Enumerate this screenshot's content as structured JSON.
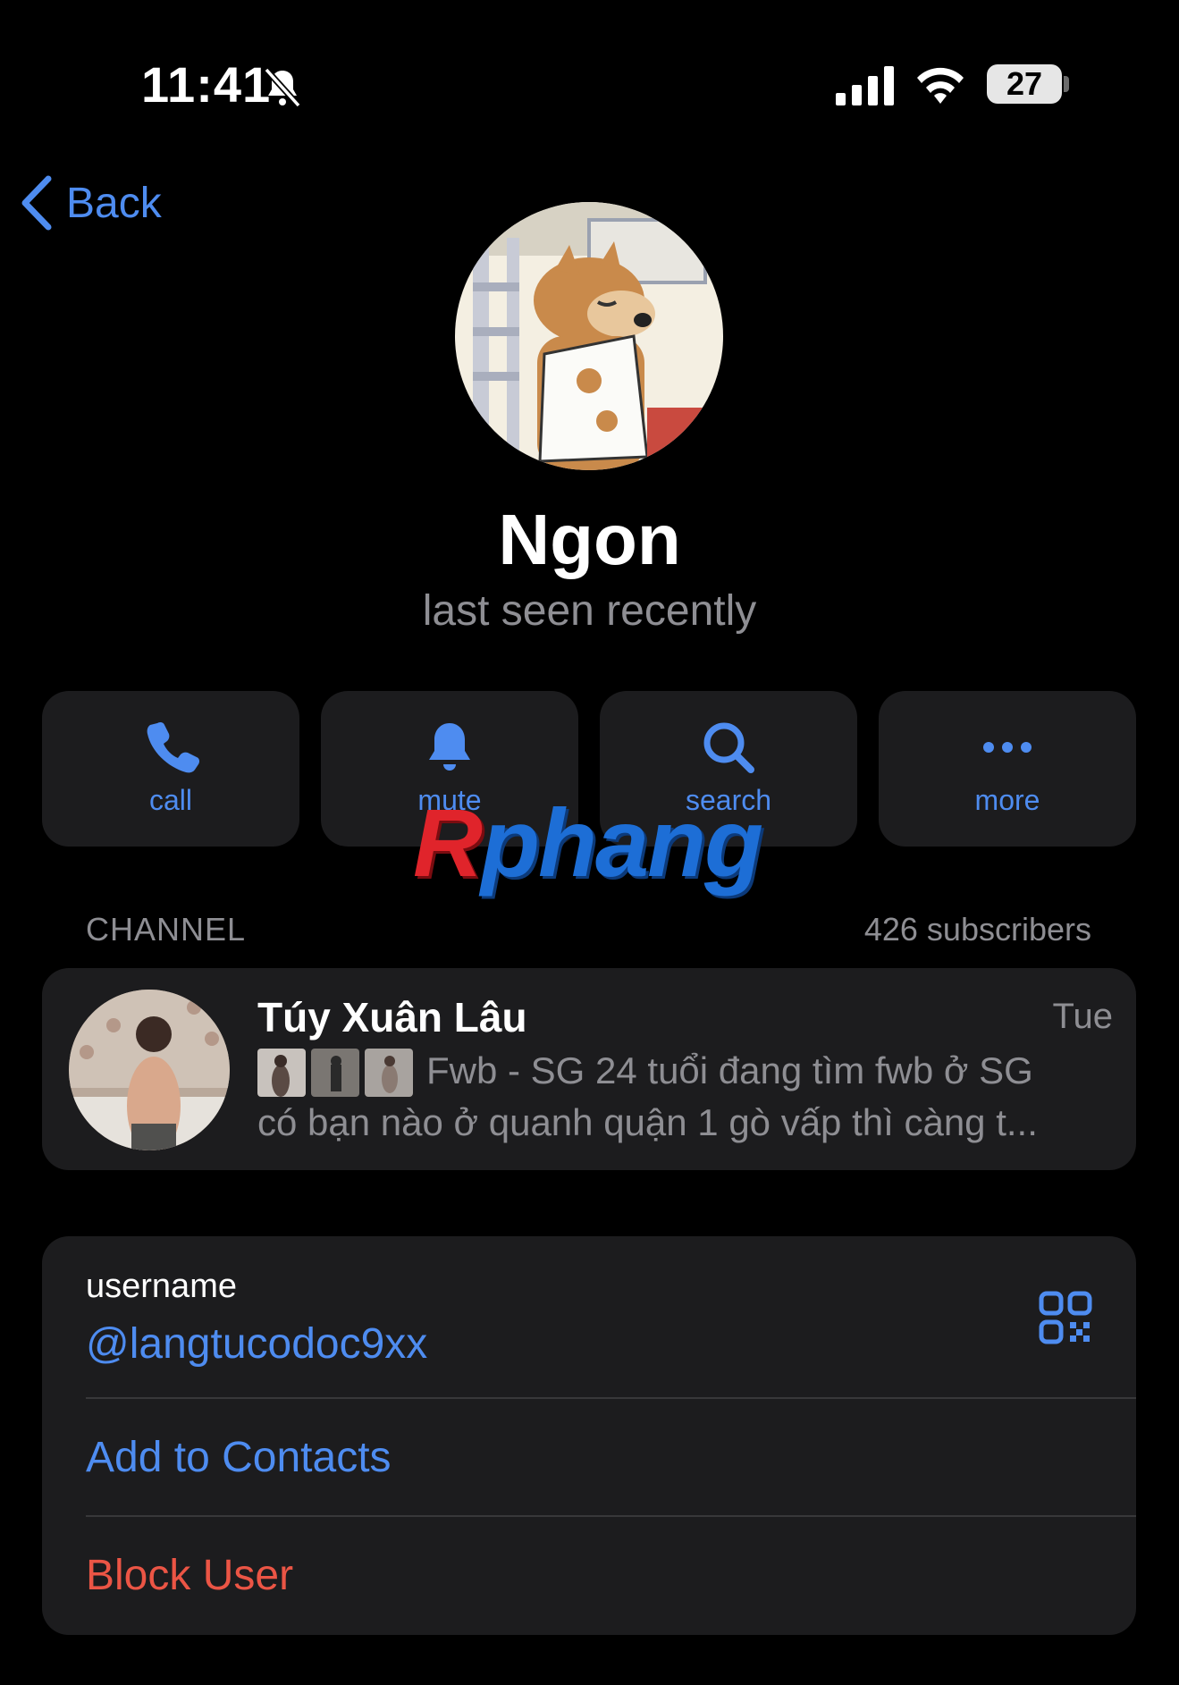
{
  "status_bar": {
    "time": "11:41",
    "battery": "27",
    "icons": [
      "bell-slash-icon",
      "signal-icon",
      "wifi-icon",
      "battery-icon"
    ]
  },
  "nav": {
    "back_label": "Back"
  },
  "profile": {
    "name": "Ngon",
    "status": "last seen recently"
  },
  "actions": [
    {
      "label": "call",
      "icon": "phone-icon"
    },
    {
      "label": "mute",
      "icon": "bell-icon"
    },
    {
      "label": "search",
      "icon": "search-icon"
    },
    {
      "label": "more",
      "icon": "more-icon"
    }
  ],
  "watermark": {
    "first": "R",
    "rest": "phang"
  },
  "channel": {
    "section_label": "CHANNEL",
    "subscribers": "426 subscribers",
    "title": "Túy Xuân Lâu",
    "date": "Tue",
    "preview_line1": "Fwb - SG 24 tuổi đang tìm fwb ở SG",
    "preview_line2": "có bạn nào ở quanh quận 1 gò vấp thì càng t..."
  },
  "info": {
    "username_label": "username",
    "username_value": "@langtucodoc9xx",
    "add_contacts": "Add to Contacts",
    "block_user": "Block User"
  },
  "colors": {
    "accent": "#4e8cf0",
    "destructive": "#eb5545",
    "card": "#1c1c1e",
    "secondary_text": "#8e8e93"
  }
}
